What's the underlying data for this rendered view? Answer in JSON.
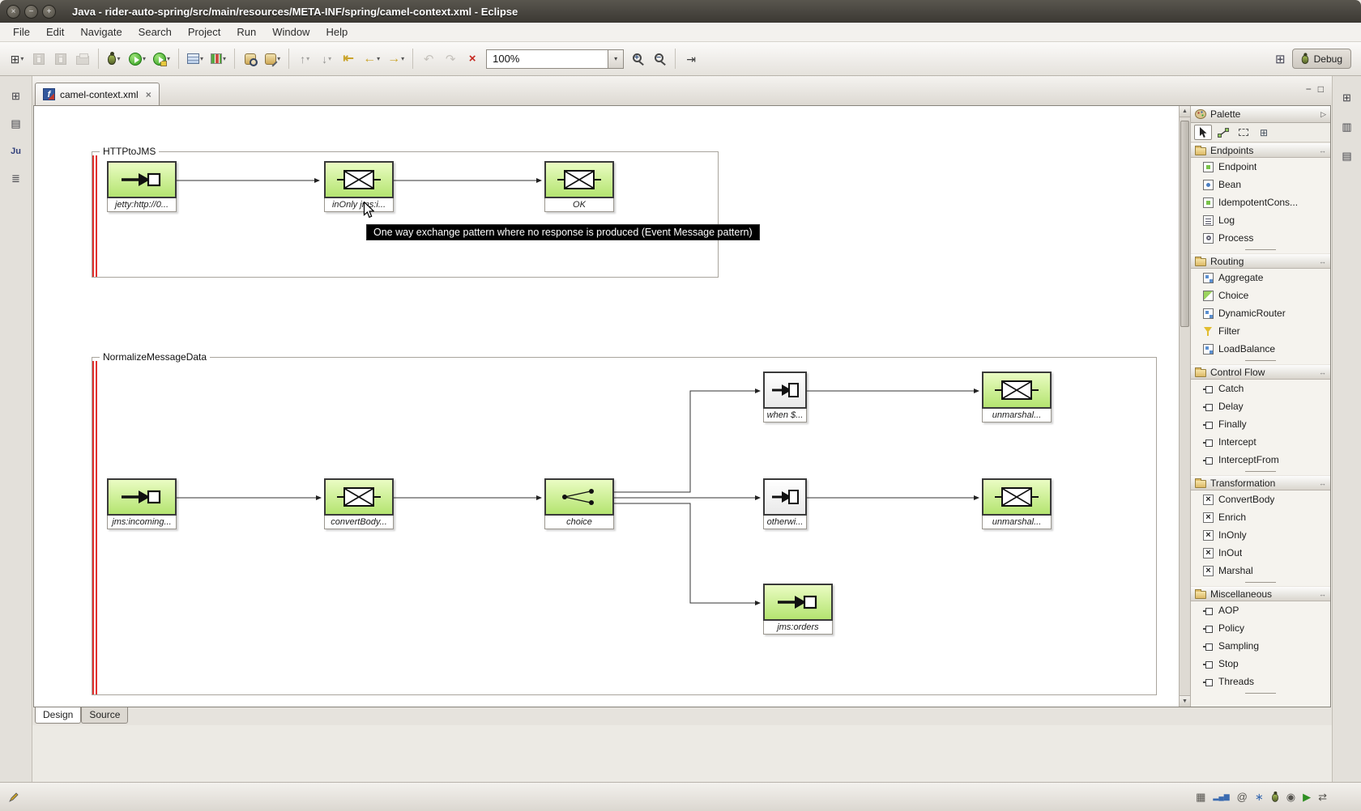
{
  "titlebar": {
    "title": "Java - rider-auto-spring/src/main/resources/META-INF/spring/camel-context.xml - Eclipse"
  },
  "menubar": {
    "items": [
      {
        "label": "File"
      },
      {
        "label": "Edit"
      },
      {
        "label": "Navigate"
      },
      {
        "label": "Search"
      },
      {
        "label": "Project"
      },
      {
        "label": "Run"
      },
      {
        "label": "Window"
      },
      {
        "label": "Help"
      }
    ]
  },
  "toolbar": {
    "zoom_value": "100%",
    "perspective": {
      "label": "Debug"
    }
  },
  "editor": {
    "tab_label": "camel-context.xml",
    "design_tab_label": "Design",
    "source_tab_label": "Source"
  },
  "canvas": {
    "tooltip_text": "One way exchange pattern where no response is produced (Event Message pattern)",
    "routes": [
      {
        "name": "HTTPtoJMS",
        "nodes": [
          {
            "label": "jetty:http://0...",
            "type": "endpoint"
          },
          {
            "label": "inOnly jms:i...",
            "type": "transform"
          },
          {
            "label": "OK",
            "type": "transform"
          }
        ]
      },
      {
        "name": "NormalizeMessageData",
        "nodes": [
          {
            "label": "jms:incoming...",
            "type": "endpoint"
          },
          {
            "label": "convertBody...",
            "type": "transform"
          },
          {
            "label": "choice",
            "type": "choice"
          },
          {
            "label": "when $...",
            "type": "eip"
          },
          {
            "label": "unmarshal...",
            "type": "transform"
          },
          {
            "label": "otherwi...",
            "type": "eip"
          },
          {
            "label": "unmarshal...",
            "type": "transform"
          },
          {
            "label": "jms:orders",
            "type": "endpoint"
          }
        ]
      }
    ]
  },
  "palette": {
    "title": "Palette",
    "sections": [
      {
        "name": "Endpoints",
        "items": [
          {
            "label": "Endpoint"
          },
          {
            "label": "Bean"
          },
          {
            "label": "IdempotentCons..."
          },
          {
            "label": "Log"
          },
          {
            "label": "Process"
          }
        ]
      },
      {
        "name": "Routing",
        "items": [
          {
            "label": "Aggregate"
          },
          {
            "label": "Choice"
          },
          {
            "label": "DynamicRouter"
          },
          {
            "label": "Filter"
          },
          {
            "label": "LoadBalance"
          }
        ]
      },
      {
        "name": "Control Flow",
        "items": [
          {
            "label": "Catch"
          },
          {
            "label": "Delay"
          },
          {
            "label": "Finally"
          },
          {
            "label": "Intercept"
          },
          {
            "label": "InterceptFrom"
          }
        ]
      },
      {
        "name": "Transformation",
        "items": [
          {
            "label": "ConvertBody"
          },
          {
            "label": "Enrich"
          },
          {
            "label": "InOnly"
          },
          {
            "label": "InOut"
          },
          {
            "label": "Marshal"
          }
        ]
      },
      {
        "name": "Miscellaneous",
        "items": [
          {
            "label": "AOP"
          },
          {
            "label": "Policy"
          },
          {
            "label": "Sampling"
          },
          {
            "label": "Stop"
          },
          {
            "label": "Threads"
          }
        ]
      }
    ]
  },
  "icons": {
    "window_close": "×",
    "window_minimize": "−",
    "window_maximize": "+",
    "new_wizard": "⊞",
    "dropdown": "▾",
    "tab_close": "×",
    "editor_minimize": "−",
    "editor_maximize": "□",
    "back_arrow": "←",
    "forward_arrow": "→",
    "undo_arrow": "↶",
    "redo_arrow": "↷",
    "prev_annotation_arrow": "↑",
    "next_annotation_arrow": "↓",
    "last_edit_arrow": "⇤",
    "fit_page_arrow": "⇥",
    "delete_cross": "×",
    "open_perspective": "⊞",
    "scroll_up": "▲",
    "scroll_down": "▼",
    "palette_collapse": "▷",
    "drawer_pin": "↔",
    "grid_tool": "⊞",
    "file_f": "f",
    "junit_label": "Ju",
    "left_restore": "⊞",
    "left_console": "▤",
    "left_hierarchy": "≣",
    "right_restore": "⊞",
    "right_book": "▥",
    "right_outline": "▤",
    "status_grid": "▦",
    "status_bars": "▂▄▆",
    "status_at": "@",
    "status_star": "∗",
    "status_target": "◉",
    "status_play": "▶",
    "status_sync": "⇄"
  }
}
